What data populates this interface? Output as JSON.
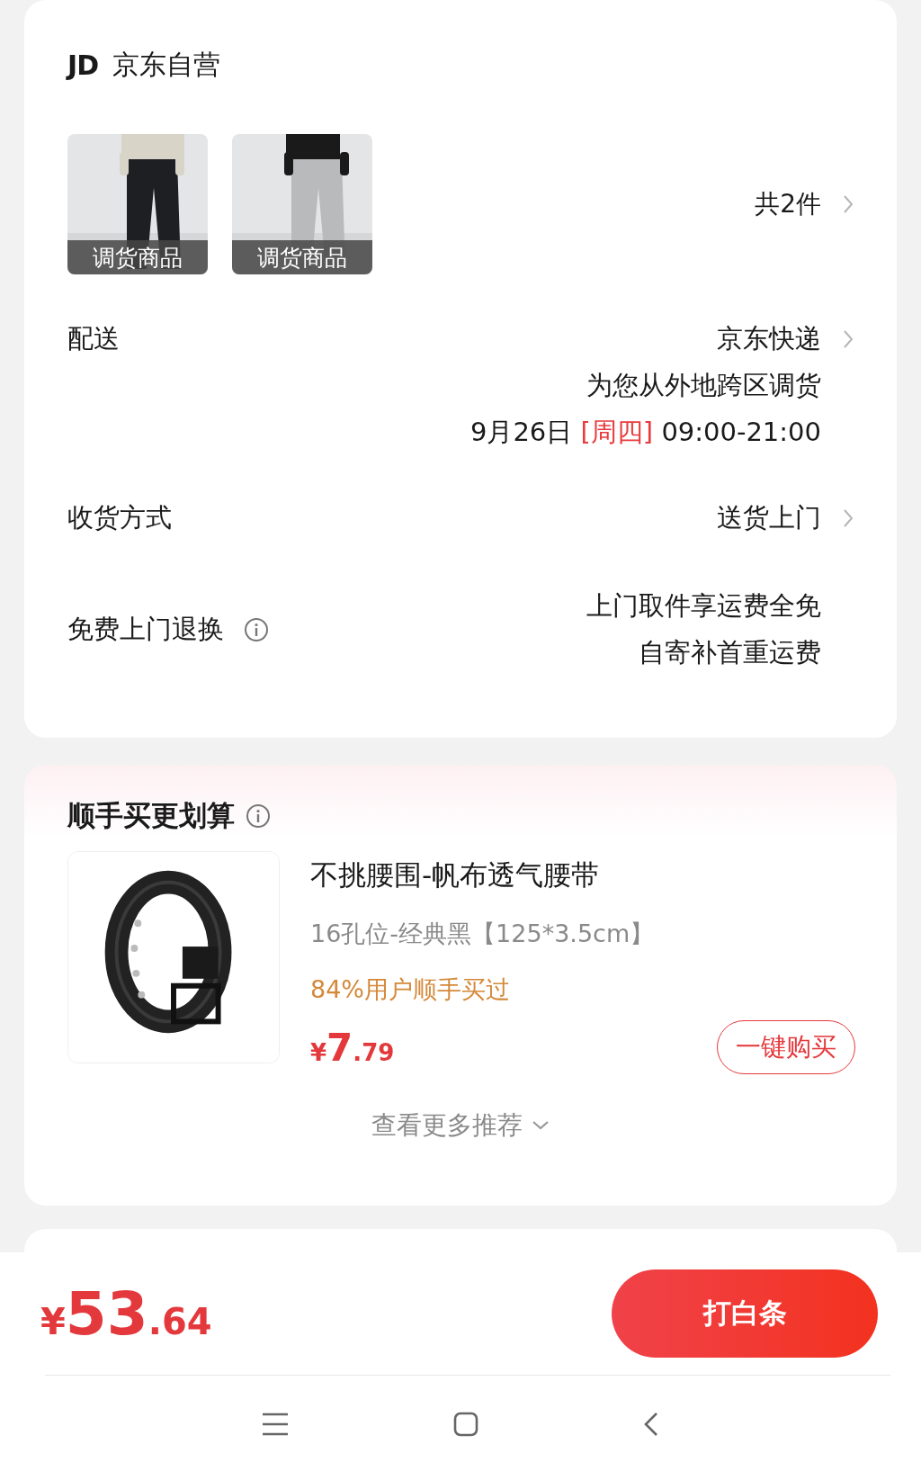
{
  "store": {
    "logo": "JD",
    "name": "京东自营"
  },
  "items": {
    "thumbnails": [
      {
        "tag": "调货商品"
      },
      {
        "tag": "调货商品"
      }
    ],
    "count": "共2件"
  },
  "delivery": {
    "label": "配送",
    "carrier": "京东快递",
    "note": "为您从外地跨区调货",
    "date": "9月26日",
    "weekday": "[周四]",
    "time": "09:00-21:00"
  },
  "receive": {
    "label": "收货方式",
    "value": "送货上门"
  },
  "returns": {
    "label": "免费上门退换",
    "lines": [
      "上门取件享运费全免",
      "自寄补首重运费"
    ]
  },
  "addon": {
    "title": "顺手买更划算",
    "product": {
      "name": "不挑腰围-帆布透气腰带",
      "spec": "16孔位-经典黑【125*3.5cm】",
      "social": "84%用户顺手买过",
      "currency": "¥",
      "price_int": "7",
      "price_dec": ".79",
      "button": "一键购买"
    },
    "more": "查看更多推荐"
  },
  "footer": {
    "currency": "¥",
    "price_int": "53",
    "price_dec": ".64",
    "button": "打白条"
  }
}
